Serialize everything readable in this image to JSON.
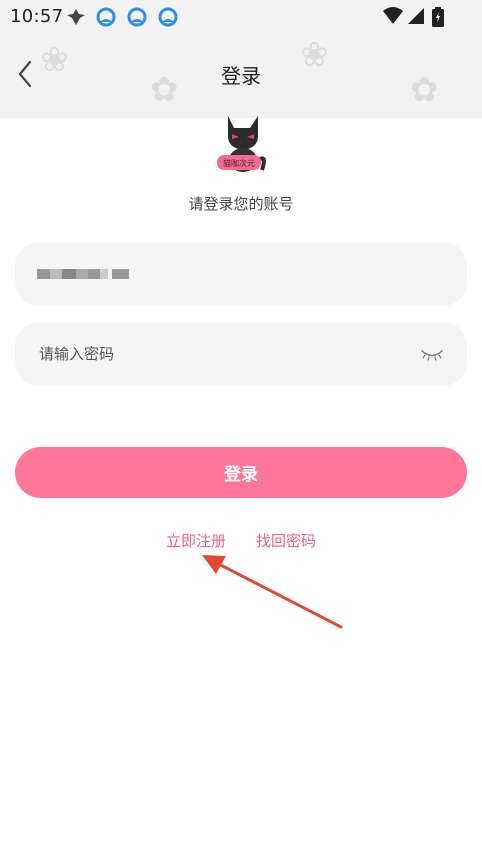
{
  "status_bar": {
    "time": "10:57",
    "icons": [
      "wind-icon",
      "app-icon",
      "app-icon",
      "app-icon",
      "wifi-icon",
      "signal-icon",
      "battery-icon"
    ]
  },
  "header": {
    "title": "登录",
    "back_icon": "back-arrow-icon"
  },
  "logo": {
    "name": "cat-mascot-logo",
    "badge_text": "猫咖次元"
  },
  "subtitle": "请登录您的账号",
  "form": {
    "account": {
      "value": "•••••••••••"
    },
    "password": {
      "placeholder": "请输入密码",
      "visibility_icon": "eye-closed-icon"
    }
  },
  "login_button": {
    "label": "登录"
  },
  "links": {
    "register": "立即注册",
    "forgot_password": "找回密码"
  },
  "annotation": {
    "type": "arrow",
    "color": "#e04a35"
  },
  "colors": {
    "accent": "#fc7698",
    "link": "#ef5f86",
    "field_bg": "#f5f5f5",
    "annotation": "#e04a35"
  }
}
